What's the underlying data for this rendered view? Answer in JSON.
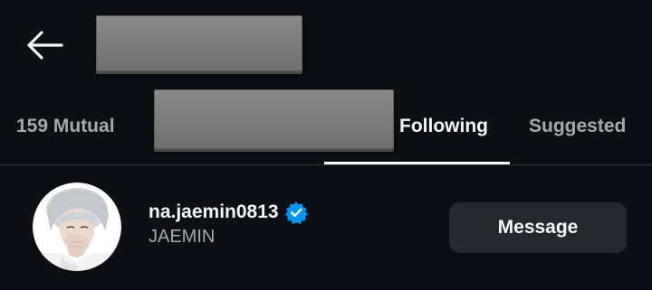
{
  "header": {
    "back_icon": "arrow-left-icon"
  },
  "tabs": [
    {
      "label": "159 Mutual",
      "active": false
    },
    {
      "label": "Following",
      "active": true
    },
    {
      "label": "Suggested",
      "active": false
    }
  ],
  "user": {
    "username": "na.jaemin0813",
    "full_name": "JAEMIN",
    "verified": true,
    "verified_icon": "verified-badge-icon",
    "avatar_icon": "profile-photo-avatar",
    "action_label": "Message"
  },
  "colors": {
    "background": "#0c1014",
    "primary_text": "#f5f5f5",
    "secondary_text": "#a8a8a8",
    "verified_blue": "#0095f6",
    "button_bg": "#25292e",
    "redaction": "#7b7b7b"
  }
}
